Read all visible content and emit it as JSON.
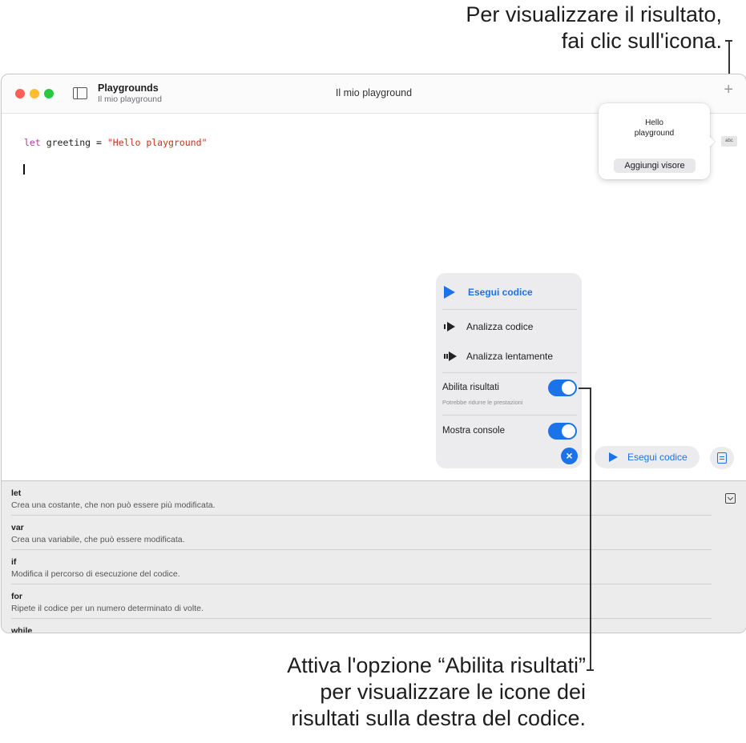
{
  "callouts": {
    "top_line1": "Per visualizzare il risultato,",
    "top_line2": "fai clic sull'icona.",
    "bottom_line1": "Attiva l'opzione “Abilita risultati”",
    "bottom_line2": "per visualizzare le icone dei",
    "bottom_line3": "risultati sulla destra del codice."
  },
  "window": {
    "app_name": "Playgrounds",
    "app_subtitle": "Il mio playground",
    "title": "Il mio playground",
    "add_icon": "+"
  },
  "code": {
    "keyword": "let",
    "identifier": " greeting = ",
    "string": "\"Hello playground\""
  },
  "result_popover": {
    "line1": "Hello",
    "line2": "playground",
    "button": "Aggiungi visore",
    "icon_label": "abc"
  },
  "run_menu": {
    "run": "Esegui codice",
    "step": "Analizza codice",
    "step_slow": "Analizza lentamente",
    "enable_results": "Abilita risultati",
    "enable_results_note": "Potrebbe ridurre le prestazioni",
    "enable_results_on": true,
    "show_console": "Mostra console",
    "show_console_on": true,
    "close_icon": "×"
  },
  "run_button": {
    "label": "Esegui codice"
  },
  "shortcuts": [
    {
      "title": "let",
      "desc": "Crea una costante, che non può essere più modificata."
    },
    {
      "title": "var",
      "desc": "Crea una variabile, che può essere modificata."
    },
    {
      "title": "if",
      "desc": "Modifica il percorso di esecuzione del codice."
    },
    {
      "title": "for",
      "desc": "Ripete il codice per un numero determinato di volte."
    },
    {
      "title": "while",
      "desc": ""
    }
  ],
  "colors": {
    "accent": "#1a73e8",
    "keyword": "#ad3da4",
    "string": "#d12f1b"
  }
}
